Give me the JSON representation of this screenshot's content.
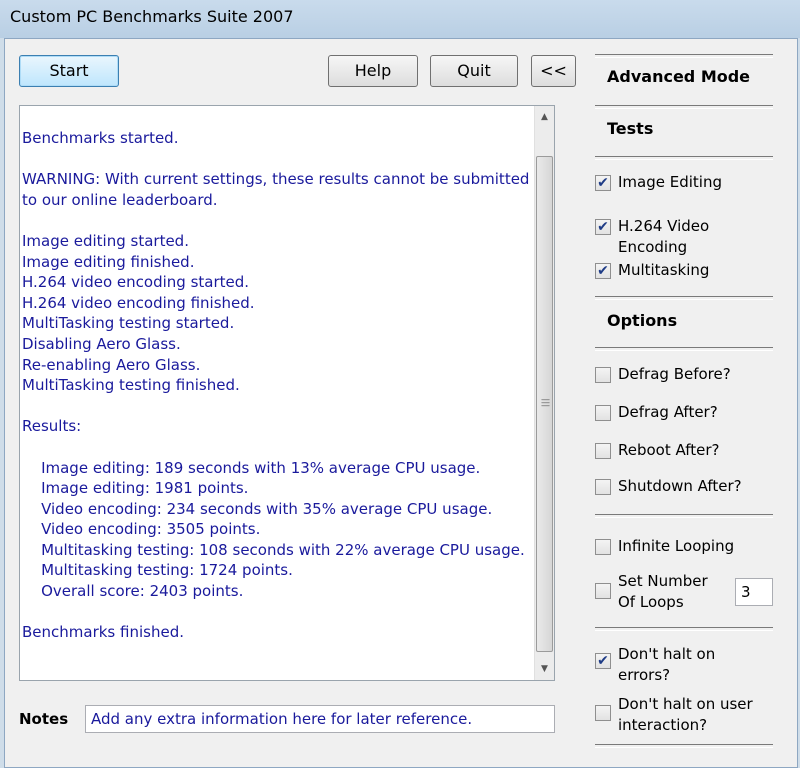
{
  "window": {
    "title": "Custom PC Benchmarks Suite 2007"
  },
  "toolbar": {
    "start_label": "Start",
    "help_label": "Help",
    "quit_label": "Quit",
    "collapse_label": "<<"
  },
  "log": {
    "text": "Benchmarks started.\n\nWARNING: With current settings, these results cannot be submitted\nto our online leaderboard.\n\nImage editing started.\nImage editing finished.\nH.264 video encoding started.\nH.264 video encoding finished.\nMultiTasking testing started.\nDisabling Aero Glass.\nRe-enabling Aero Glass.\nMultiTasking testing finished.\n\nResults:\n\n    Image editing: 189 seconds with 13% average CPU usage.\n    Image editing: 1981 points.\n    Video encoding: 234 seconds with 35% average CPU usage.\n    Video encoding: 3505 points.\n    Multitasking testing: 108 seconds with 22% average CPU usage.\n    Multitasking testing: 1724 points.\n    Overall score: 2403 points.\n\nBenchmarks finished."
  },
  "notes": {
    "label": "Notes",
    "value": "Add any extra information here for later reference."
  },
  "panel": {
    "mode_heading": "Advanced Mode",
    "tests_heading": "Tests",
    "options_heading": "Options",
    "tests": [
      {
        "label": "Image Editing",
        "checked": true
      },
      {
        "label": "H.264 Video Encoding",
        "checked": true
      },
      {
        "label": "Multitasking",
        "checked": true
      }
    ],
    "options": [
      {
        "label": "Defrag Before?",
        "checked": false
      },
      {
        "label": "Defrag After?",
        "checked": false
      },
      {
        "label": "Reboot After?",
        "checked": false
      },
      {
        "label": "Shutdown After?",
        "checked": false
      }
    ],
    "looping": [
      {
        "label": "Infinite Looping",
        "checked": false
      },
      {
        "label": "Set Number Of Loops",
        "checked": false
      }
    ],
    "loops_value": "3",
    "halt": [
      {
        "label": "Don't halt on errors?",
        "checked": true
      },
      {
        "label": "Don't halt on user interaction?",
        "checked": false
      }
    ]
  }
}
